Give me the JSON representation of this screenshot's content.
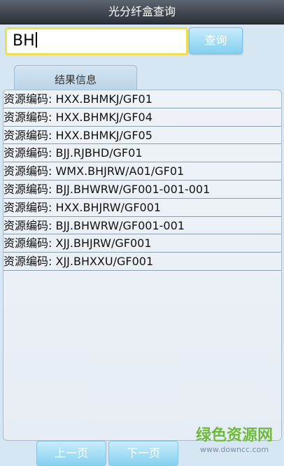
{
  "window": {
    "title": "光分纤盒查询"
  },
  "search": {
    "value": "BH",
    "query_label": "查询"
  },
  "results": {
    "tab_label": "结果信息",
    "items": [
      "资源编码: HXX.BHMKJ/GF01",
      "资源编码: HXX.BHMKJ/GF04",
      "资源编码: HXX.BHMKJ/GF05",
      "资源编码: BJJ.RJBHD/GF01",
      "资源编码: WMX.BHJRW/A01/GF01",
      "资源编码: BJJ.BHWRW/GF001-001-001",
      "资源编码: HXX.BHJRW/GF001",
      "资源编码: BJJ.BHWRW/GF001-001",
      "资源编码: XJJ.BHJRW/GF001",
      "资源编码: XJJ.BHXXU/GF001"
    ]
  },
  "pagination": {
    "prev_label": "上一页",
    "next_label": "下一页"
  },
  "watermark": {
    "text": "绿色资源网",
    "url_text": "www.downcc.com"
  }
}
